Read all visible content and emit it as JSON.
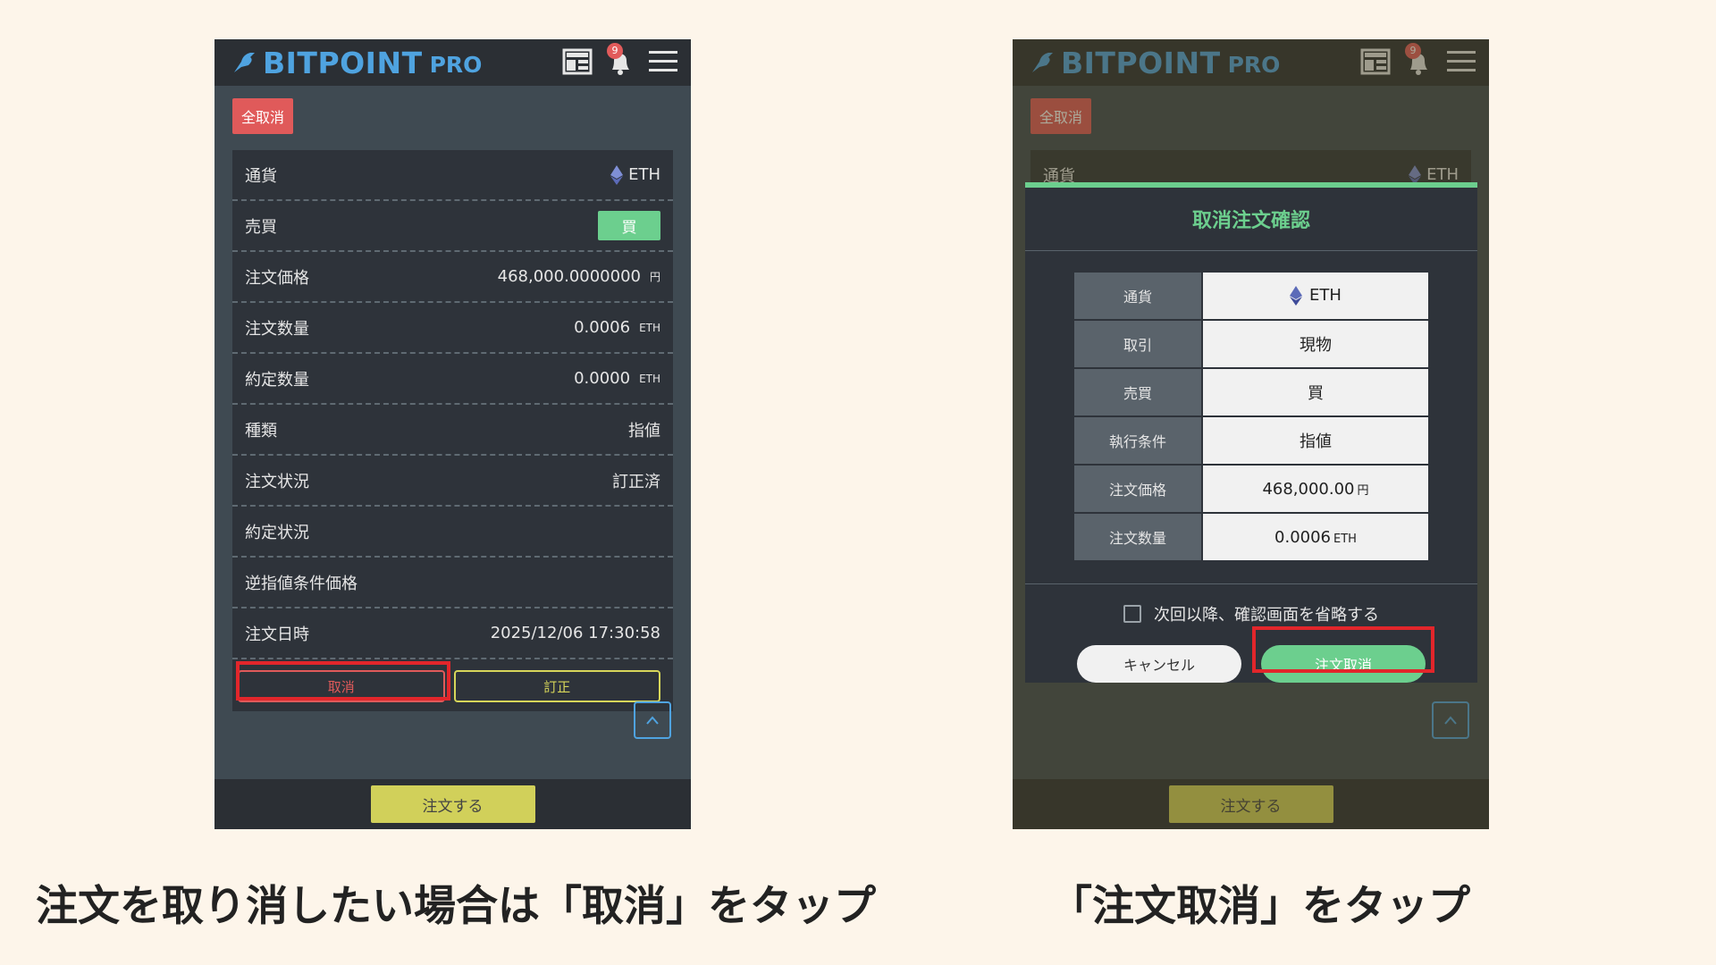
{
  "left": {
    "logo": {
      "brand": "BITPOINT",
      "pro": "PRO"
    },
    "notification_count": "9",
    "cancel_all": "全取消",
    "rows": [
      {
        "label": "通貨",
        "value": "ETH"
      },
      {
        "label": "売買",
        "value": "買"
      },
      {
        "label": "注文価格",
        "value": "468,000.0000000",
        "unit": "円"
      },
      {
        "label": "注文数量",
        "value": "0.0006",
        "unit": "ETH"
      },
      {
        "label": "約定数量",
        "value": "0.0000",
        "unit": "ETH"
      },
      {
        "label": "種類",
        "value": "指値"
      },
      {
        "label": "注文状況",
        "value": "訂正済"
      },
      {
        "label": "約定状況",
        "value": ""
      },
      {
        "label": "逆指値条件価格",
        "value": ""
      },
      {
        "label": "注文日時",
        "value": "2025/12/06 17:30:58"
      }
    ],
    "cancel_btn": "取消",
    "modify_btn": "訂正",
    "order_btn": "注文する"
  },
  "right": {
    "logo": {
      "brand": "BITPOINT",
      "pro": "PRO"
    },
    "notification_count": "9",
    "cancel_all": "全取消",
    "bg_row": {
      "label": "通貨",
      "value": "ETH"
    },
    "modal": {
      "title": "取消注文確認",
      "rows": [
        {
          "label": "通貨",
          "value": "ETH"
        },
        {
          "label": "取引",
          "value": "現物"
        },
        {
          "label": "売買",
          "value": "買"
        },
        {
          "label": "執行条件",
          "value": "指値"
        },
        {
          "label": "注文価格",
          "value": "468,000.00",
          "unit": "円"
        },
        {
          "label": "注文数量",
          "value": "0.0006",
          "unit": "ETH"
        }
      ],
      "skip_label": "次回以降、確認画面を省略する",
      "cancel_btn": "キャンセル",
      "confirm_btn": "注文取消"
    },
    "order_btn": "注文する"
  },
  "captions": {
    "left": "注文を取り消したい場合は「取消」をタップ",
    "right": "「注文取消」をタップ"
  },
  "colors": {
    "accent_green": "#6ccf8e",
    "accent_red": "#e05a5a",
    "accent_blue": "#4fa3e0",
    "accent_yellow": "#d1d05a",
    "highlight_red": "#e2262b"
  }
}
